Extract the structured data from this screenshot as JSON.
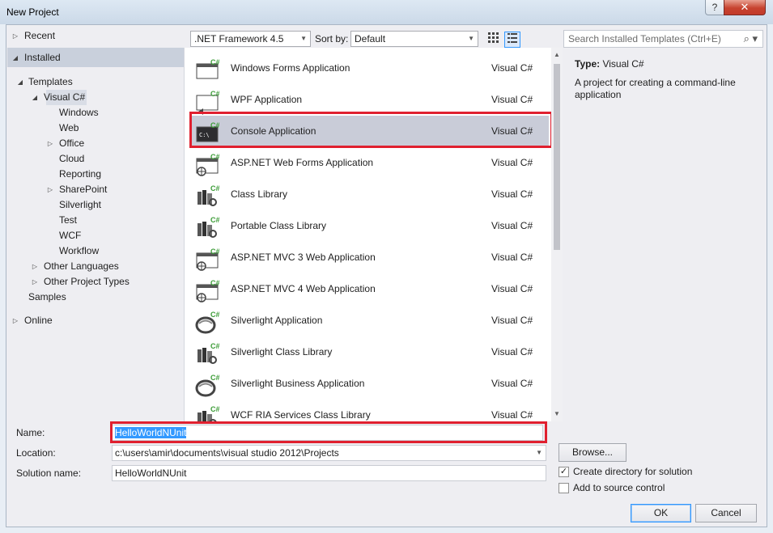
{
  "window": {
    "title": "New Project",
    "help": "?",
    "close": "✕"
  },
  "sidebar": {
    "recent": "Recent",
    "installed": "Installed",
    "templates": "Templates",
    "visual_c": "Visual C#",
    "children": [
      "Windows",
      "Web",
      "Office",
      "Cloud",
      "Reporting",
      "SharePoint",
      "Silverlight",
      "Test",
      "WCF",
      "Workflow"
    ],
    "other_languages": "Other Languages",
    "other_project_types": "Other Project Types",
    "samples": "Samples",
    "online": "Online"
  },
  "toolbar": {
    "framework": ".NET Framework 4.5",
    "sort_label": "Sort by:",
    "sort_value": "Default",
    "search_placeholder": "Search Installed Templates (Ctrl+E)"
  },
  "templates": [
    {
      "name": "Windows Forms Application",
      "lang": "Visual C#",
      "icon": "windows-forms-icon"
    },
    {
      "name": "WPF Application",
      "lang": "Visual C#",
      "icon": "wpf-icon"
    },
    {
      "name": "Console Application",
      "lang": "Visual C#",
      "icon": "console-icon"
    },
    {
      "name": "ASP.NET Web Forms Application",
      "lang": "Visual C#",
      "icon": "web-forms-icon"
    },
    {
      "name": "Class Library",
      "lang": "Visual C#",
      "icon": "class-library-icon"
    },
    {
      "name": "Portable Class Library",
      "lang": "Visual C#",
      "icon": "portable-library-icon"
    },
    {
      "name": "ASP.NET MVC 3 Web Application",
      "lang": "Visual C#",
      "icon": "mvc3-icon"
    },
    {
      "name": "ASP.NET MVC 4 Web Application",
      "lang": "Visual C#",
      "icon": "mvc4-icon"
    },
    {
      "name": "Silverlight Application",
      "lang": "Visual C#",
      "icon": "silverlight-icon"
    },
    {
      "name": "Silverlight Class Library",
      "lang": "Visual C#",
      "icon": "silverlight-library-icon"
    },
    {
      "name": "Silverlight Business Application",
      "lang": "Visual C#",
      "icon": "silverlight-business-icon"
    },
    {
      "name": "WCF RIA Services Class Library",
      "lang": "Visual C#",
      "icon": "wcf-ria-icon"
    }
  ],
  "description": {
    "type_label": "Type:",
    "type_value": "Visual C#",
    "text": "A project for creating a command-line application"
  },
  "form": {
    "name_label": "Name:",
    "name_value": "HelloWorldNUnit",
    "location_label": "Location:",
    "location_value": "c:\\users\\amir\\documents\\visual studio 2012\\Projects",
    "solution_label": "Solution name:",
    "solution_value": "HelloWorldNUnit",
    "browse": "Browse...",
    "create_dir": "Create directory for solution",
    "create_dir_checked": true,
    "add_source": "Add to source control",
    "add_source_checked": false,
    "ok": "OK",
    "cancel": "Cancel"
  },
  "colors": {
    "highlight": "#e0202f",
    "selection": "#3399ff"
  }
}
